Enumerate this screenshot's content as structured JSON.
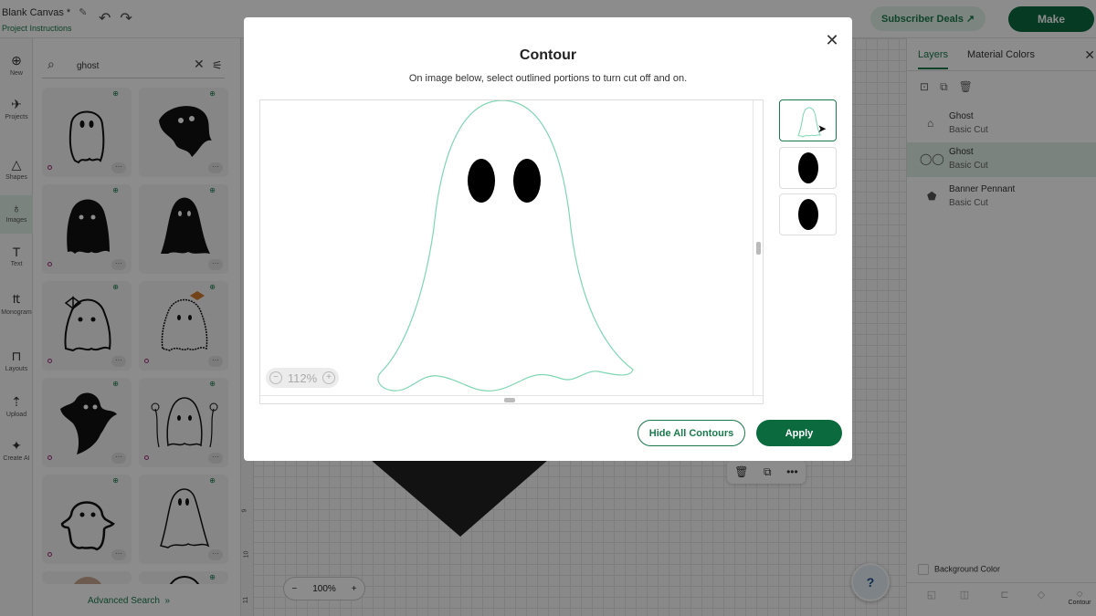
{
  "app": {
    "canvas_title": "Blank Canvas *",
    "project_instructions": "Project Instructions",
    "subscriber_deals": "Subscriber Deals",
    "make_label": "Make"
  },
  "leftnav": {
    "items": [
      {
        "label": "New",
        "icon": "plus-icon"
      },
      {
        "label": "Projects",
        "icon": "rocket-icon"
      },
      {
        "label": "Shapes",
        "icon": "shapes-icon"
      },
      {
        "label": "Images",
        "icon": "lightbulb-icon"
      },
      {
        "label": "Text",
        "icon": "text-icon"
      },
      {
        "label": "Monogram",
        "icon": "monogram-icon"
      },
      {
        "label": "Layouts",
        "icon": "shirt-icon"
      },
      {
        "label": "Upload",
        "icon": "upload-icon"
      },
      {
        "label": "Create AI",
        "icon": "sparkle-icon"
      }
    ]
  },
  "images_panel": {
    "search_value": "ghost",
    "advanced_search": "Advanced Search"
  },
  "workarea": {
    "zoom": "100%",
    "ruler_marks": [
      "9",
      "10",
      "11"
    ]
  },
  "right_panel": {
    "tabs": [
      "Layers",
      "Material Colors"
    ],
    "layers": [
      {
        "name": "Ghost",
        "type": "Basic Cut",
        "selected": false
      },
      {
        "name": "Ghost",
        "type": "Basic Cut",
        "selected": true
      },
      {
        "name": "Banner Pennant",
        "type": "Basic Cut",
        "selected": false
      }
    ],
    "background_color": "Background Color",
    "bottom_tool": "Contour"
  },
  "modal": {
    "title": "Contour",
    "subtitle": "On image below, select outlined portions to turn cut off and on.",
    "zoom": "112%",
    "hide_all": "Hide All Contours",
    "apply": "Apply",
    "contour_count": 3
  },
  "colors": {
    "accent": "#1a7a4c",
    "primary_button": "#0b6b3e",
    "contour_line": "#7fd6b3"
  }
}
